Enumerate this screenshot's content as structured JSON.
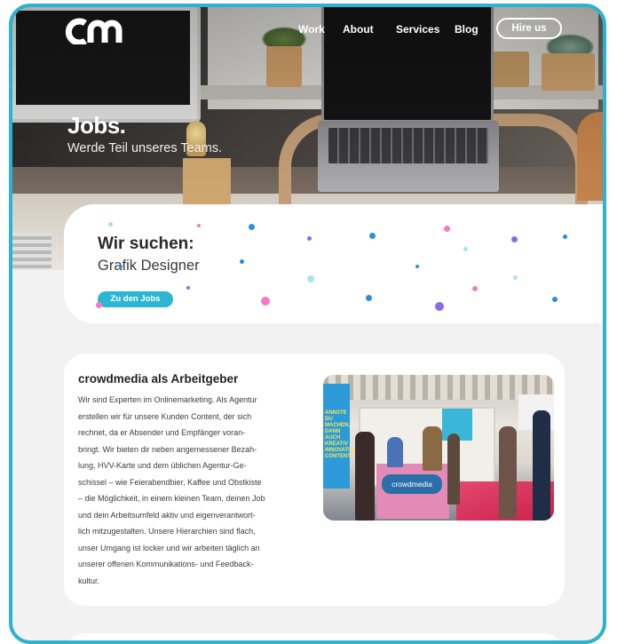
{
  "nav": {
    "logo_alt": "cm",
    "work": "Work",
    "about": "About",
    "services": "Services",
    "blog": "Blog",
    "hire": "Hire us"
  },
  "hero": {
    "title": "Jobs.",
    "subtitle": "Werde Teil unseres Teams."
  },
  "jobs": {
    "heading": "Wir suchen:",
    "position": "Grafik Designer",
    "button": "Zu den Jobs"
  },
  "employer": {
    "title": "crowdmedia als Arbeitgeber",
    "lines": [
      "Wir sind Experten im Onlinemarketing. Als Agentur",
      "erstellen wir für unsere Kunden Content, der sich",
      "rechnet, da er Absender und Empfänger voran-",
      "bringt. Wir bieten dir neben angemessener Bezah-",
      "lung, HVV-Karte und dem üblichen Agentur-Ge-",
      "schissel – wie Feierabendbier, Kaffee und Obstkiste",
      "– die Möglichkeit, in einem kleinen Team, deinen Job",
      "und dein Arbeitsumfeld aktiv und eigenverantwort-",
      "lich mitzugestalten. Unsere Hierarchien sind flach,",
      "unser Umgang ist locker und wir arbeiten täglich an",
      "unserer offenen Kommunikations- und Feedback-",
      "kultur."
    ],
    "photo_logo": "crowdmedia",
    "photo_banner": "ANNSTE DU MACHEN, DANN AUCH KREATIV INNOVATIVER CONTENT"
  },
  "colors": {
    "accent": "#2bb7d3",
    "frame": "#2bb3cf",
    "pink": "#f27bc4",
    "purple": "#8d6be8",
    "blue": "#2b8fe0"
  }
}
